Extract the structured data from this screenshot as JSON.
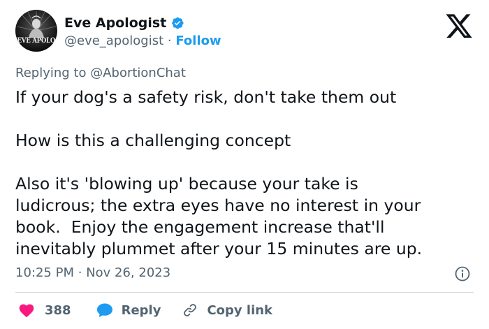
{
  "author": {
    "display_name": "Eve Apologist",
    "handle": "@eve_apologist",
    "separator": "·",
    "follow_label": "Follow",
    "avatar_text": "EVE APOLOGIST",
    "verified": true
  },
  "reply_context": {
    "prefix": "Replying to ",
    "mention": "@AbortionChat"
  },
  "tweet": {
    "paragraphs": [
      "If your dog's a safety risk, don't take them out",
      "How is this a challenging concept",
      "Also it's 'blowing up' because your take is\nludicrous; the extra eyes have no interest in your\nbook.  Enjoy the engagement increase that'll\ninevitably plummet after your 15 minutes are up."
    ]
  },
  "timestamp": {
    "time": "10:25 PM",
    "separator": "·",
    "date": "Nov 26, 2023"
  },
  "actions": {
    "like_count": "388",
    "reply_label": "Reply",
    "copy_link_label": "Copy link"
  },
  "icons": {
    "platform_logo": "x-logo-icon",
    "verified": "verified-badge-icon",
    "info": "info-icon",
    "like": "heart-icon",
    "reply": "speech-bubble-icon",
    "copy": "link-icon"
  },
  "colors": {
    "accent": "#1d9bf0",
    "like": "#f91880",
    "text": "#0f1419",
    "secondary": "#536471",
    "divider": "#cfd9de"
  }
}
